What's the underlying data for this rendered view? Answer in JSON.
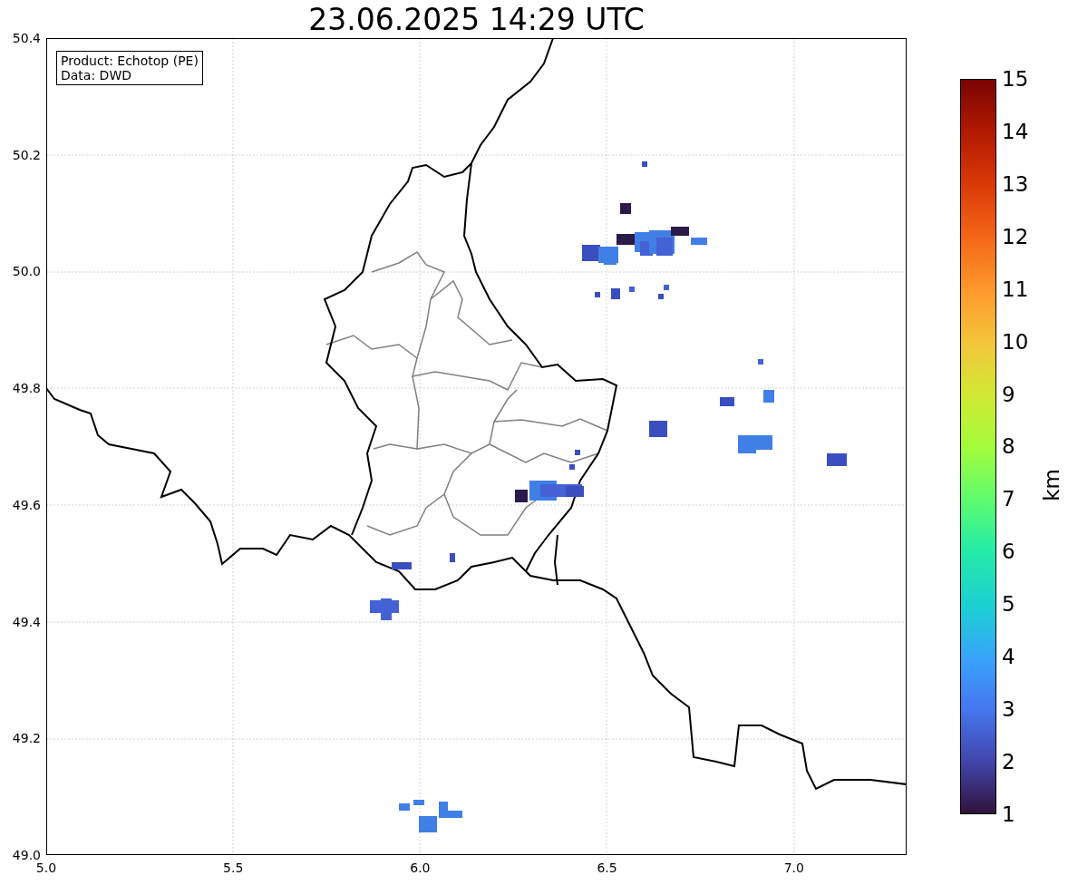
{
  "title": "23.06.2025 14:29 UTC",
  "info_box": {
    "lines": [
      "Product: Echotop (PE)",
      "Data: DWD"
    ]
  },
  "x_axis": {
    "ticks": [
      "5.0",
      "5.5",
      "6.0",
      "6.5",
      "7.0"
    ]
  },
  "y_axis": {
    "ticks": [
      "50.4",
      "50.2",
      "50.0",
      "49.8",
      "49.6",
      "49.4",
      "49.2",
      "49.0"
    ]
  },
  "colorbar": {
    "label": "km",
    "ticks": [
      "15",
      "14",
      "13",
      "12",
      "11",
      "10",
      "9",
      "8",
      "7",
      "6",
      "5",
      "4",
      "3",
      "2",
      "1"
    ]
  }
}
